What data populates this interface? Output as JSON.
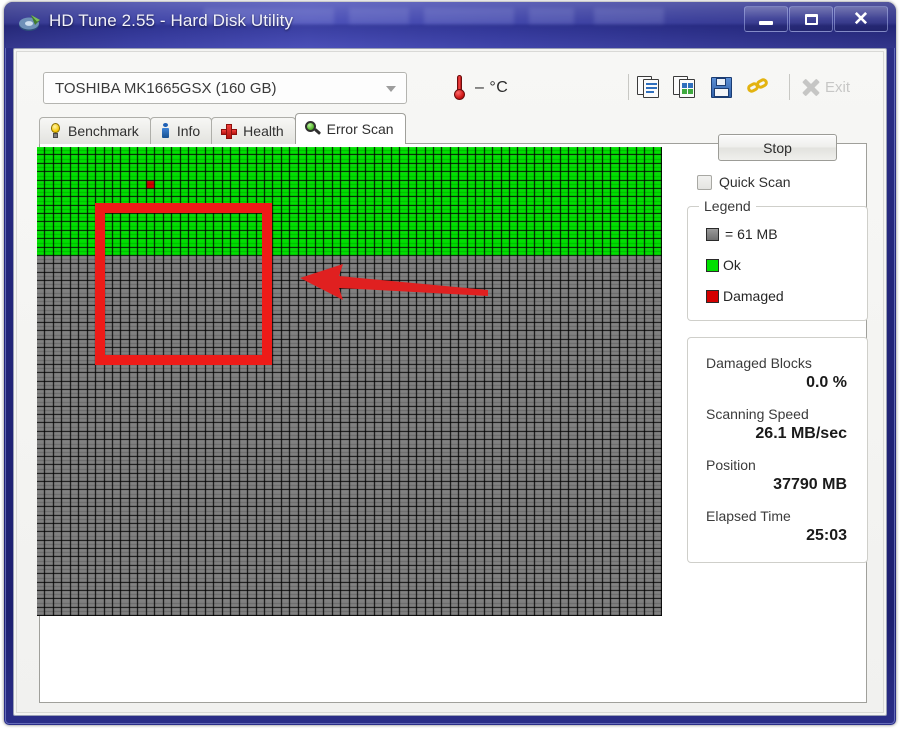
{
  "window": {
    "title": "HD Tune 2.55 - Hard Disk Utility",
    "app_icon": "hd-tune-disk-icon",
    "minimize_label": "–",
    "maximize_label": "□",
    "close_label": "✕",
    "frame_color": "#25287c",
    "title_color": "#f2f2fa"
  },
  "toolbar": {
    "drive": {
      "selected": "TOSHIBA MK1665GSX (160 GB)",
      "icon": "chevron-down-icon"
    },
    "temperature": {
      "icon": "thermometer-icon",
      "value": "– °C"
    },
    "icons": [
      {
        "name": "copy-text-icon",
        "tooltip": "Copy text"
      },
      {
        "name": "copy-image-icon",
        "tooltip": "Copy image"
      },
      {
        "name": "save-icon",
        "tooltip": "Save"
      },
      {
        "name": "link-icon",
        "tooltip": "Link"
      }
    ],
    "exit": {
      "label": "Exit",
      "icon": "close-x-icon",
      "enabled": false
    }
  },
  "tabs": [
    {
      "label": "Benchmark",
      "icon": "lightbulb-icon",
      "active": false
    },
    {
      "label": "Info",
      "icon": "info-icon",
      "active": false
    },
    {
      "label": "Health",
      "icon": "red-cross-icon",
      "active": false
    },
    {
      "label": "Error Scan",
      "icon": "magnifier-icon",
      "active": true
    }
  ],
  "scan": {
    "stop_button": "Stop",
    "quick_scan": {
      "label": "Quick Scan",
      "checked": false
    },
    "legend": {
      "title": "Legend",
      "block_size": "= 61 MB",
      "ok_label": "Ok",
      "damaged_label": "Damaged",
      "color_ok": "#00e000",
      "color_damaged": "#d40000",
      "color_unscanned": "#808080"
    },
    "stats": [
      {
        "label": "Damaged Blocks",
        "value": "0.0 %"
      },
      {
        "label": "Scanning Speed",
        "value": "26.1 MB/sec"
      },
      {
        "label": "Position",
        "value": "37790 MB"
      },
      {
        "label": "Elapsed Time",
        "value": "25:03"
      }
    ]
  },
  "grid": {
    "columns": 74,
    "rows": 56,
    "scanned_rows": 13,
    "damaged_blocks": [
      {
        "col": 13,
        "row": 4
      }
    ],
    "color_ok": "#00e000",
    "color_damaged": "#d40000",
    "color_unscanned": "#808080",
    "color_gap": "#000000"
  },
  "annotations": [
    {
      "name": "highlight-rectangle",
      "color": "#ee1b18",
      "shape": "rectangle"
    },
    {
      "name": "pointer-arrow",
      "color": "#e02020",
      "shape": "arrow-left"
    }
  ]
}
